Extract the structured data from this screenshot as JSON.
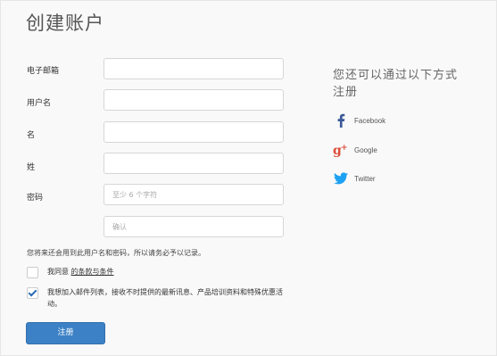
{
  "page": {
    "title": "创建账户"
  },
  "form": {
    "email": {
      "label": "电子邮箱",
      "value": "",
      "placeholder": ""
    },
    "username": {
      "label": "用户名",
      "value": "",
      "placeholder": ""
    },
    "first_name": {
      "label": "名",
      "value": "",
      "placeholder": ""
    },
    "last_name": {
      "label": "姓",
      "value": "",
      "placeholder": ""
    },
    "password": {
      "label": "密码",
      "value": "",
      "placeholder": "至少 6 个字符"
    },
    "confirm": {
      "value": "",
      "placeholder": "确认"
    },
    "note": "您将来还会用到此用户名和密码，所以请务必予以记录。",
    "agree": {
      "checked": false,
      "text": "我同意",
      "link": "的条款与条件"
    },
    "newsletter": {
      "checked": true,
      "text": "我想加入邮件列表，接收不时提供的最新讯息、产品培训资料和特殊优惠活动。"
    },
    "submit_label": "注册"
  },
  "alternatives": {
    "title": "您还可以通过以下方式注册",
    "providers": [
      {
        "name": "Facebook",
        "icon": "facebook-icon",
        "color": "#3b5998"
      },
      {
        "name": "Google",
        "icon": "google-plus-icon",
        "color": "#dd4b39"
      },
      {
        "name": "Twitter",
        "icon": "twitter-icon",
        "color": "#1da1f2"
      }
    ]
  }
}
